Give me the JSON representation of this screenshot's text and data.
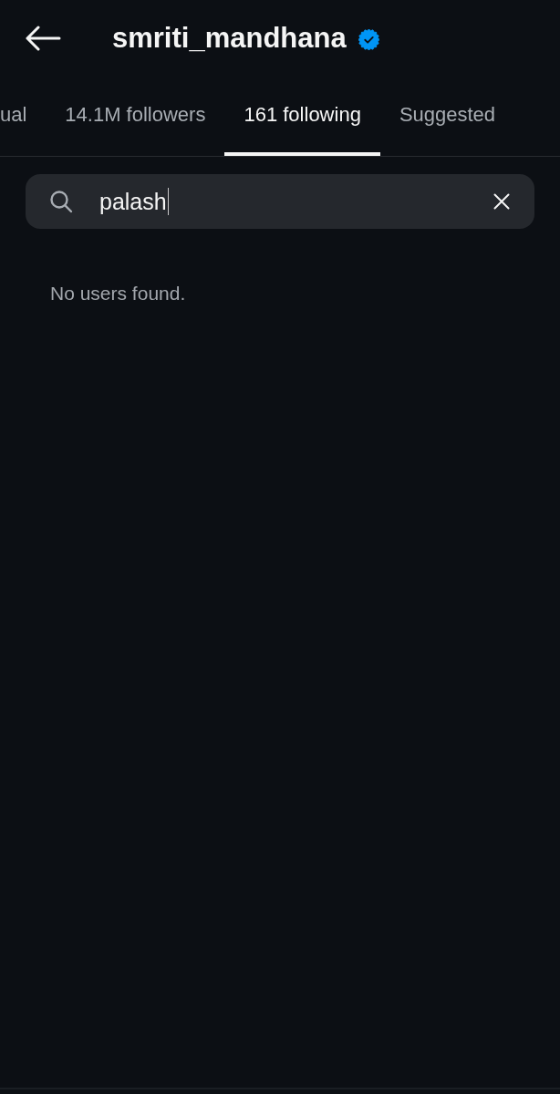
{
  "header": {
    "title": "smriti_mandhana",
    "verified": true
  },
  "tabs": [
    {
      "label": "ual",
      "selected": false
    },
    {
      "label": "14.1M followers",
      "selected": false
    },
    {
      "label": "161 following",
      "selected": true
    },
    {
      "label": "Suggested",
      "selected": false
    }
  ],
  "search": {
    "value": "palash",
    "focused": true
  },
  "empty_message": "No users found."
}
